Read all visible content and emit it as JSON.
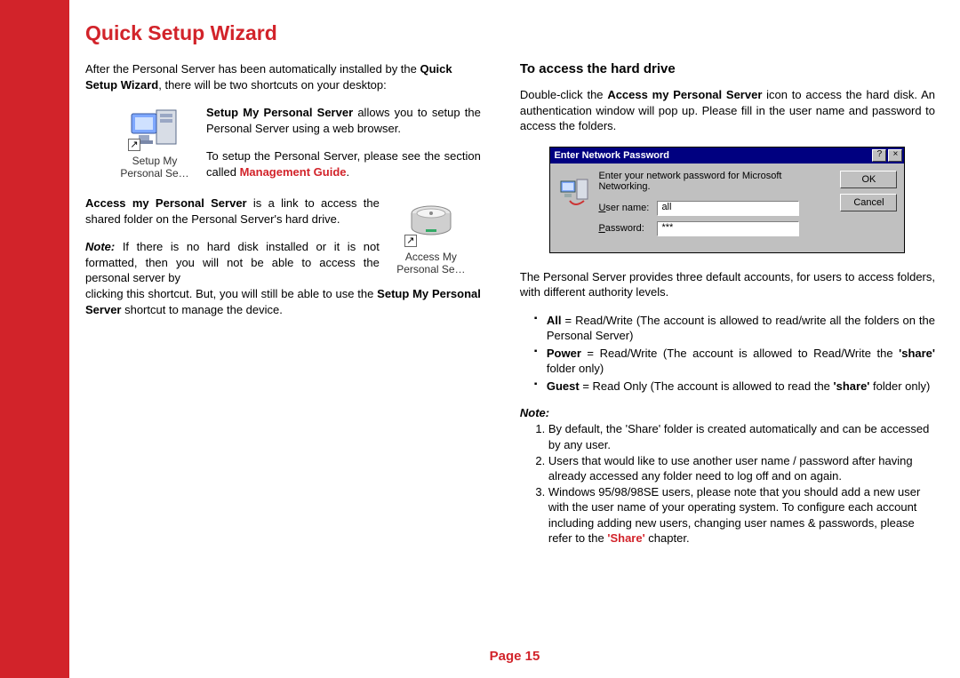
{
  "title": "Quick Setup Wizard",
  "left": {
    "intro_a": "After the Personal Server has been automatically installed by the ",
    "intro_b": "Quick Setup Wizard",
    "intro_c": ", there will be two shortcuts on your desktop:",
    "setup_icon_label": "Setup My Personal Se…",
    "setup_desc_a": "Setup My Personal Server",
    "setup_desc_b": " allows you to setup the Personal Server using a web browser.",
    "setup_desc2_a": "To setup the Personal Server, please see the section called ",
    "setup_desc2_link": "Management Guide",
    "setup_desc2_c": ".",
    "access_icon_label": "Access My Personal Se…",
    "access_a": "Access my Personal Server",
    "access_b": " is a link to access the shared folder on the Personal Server's hard drive.",
    "note_a": "Note:",
    "note_b": " If there is no hard disk installed or it is not formatted, then you will not be able to access the personal server by clicking this shortcut. But, you will still be able to use the ",
    "note_c": "Setup My Personal Server",
    "note_d": " shortcut to manage the device."
  },
  "right": {
    "heading": "To access the hard drive",
    "p1_a": "Double-click the ",
    "p1_b": "Access my Personal Server",
    "p1_c": " icon to access the hard disk. An authentication window will pop up. Please fill in the user name and password to access the folders.",
    "dialog": {
      "title": "Enter Network Password",
      "instruction": "Enter your network password for Microsoft Networking.",
      "user_label_u": "U",
      "user_label_rest": "ser name:",
      "pass_label_u": "P",
      "pass_label_rest": "assword:",
      "user_value": "all",
      "pass_value": "***",
      "ok": "OK",
      "cancel": "Cancel",
      "help": "?",
      "close": "×"
    },
    "p2": "The Personal Server provides three default accounts, for users to access folders, with different authority levels.",
    "acct1_a": "All",
    "acct1_b": " = Read/Write (The account is allowed to read/write all the folders on the Personal Server)",
    "acct2_a": "Power",
    "acct2_b": " = Read/Write (The account is allowed to Read/Write the ",
    "acct2_c": "'share'",
    "acct2_d": " folder only)",
    "acct3_a": "Guest",
    "acct3_b": " = Read Only (The account is allowed to read the ",
    "acct3_c": "'share'",
    "acct3_d": " folder only)",
    "note_heading": "Note:",
    "note1": "By default, the 'Share' folder is created automatically and can be accessed by any user.",
    "note2": "Users that would like to use another user name / password after having already accessed any folder need to log off and on again.",
    "note3_a": "Windows 95/98/98SE users, please note that you should add a new user with the user name of your operating system. To configure each account including adding new users, changing user names & passwords, please refer to the ",
    "note3_b": "'Share'",
    "note3_c": " chapter."
  },
  "footer_a": "Page ",
  "footer_b": "15"
}
